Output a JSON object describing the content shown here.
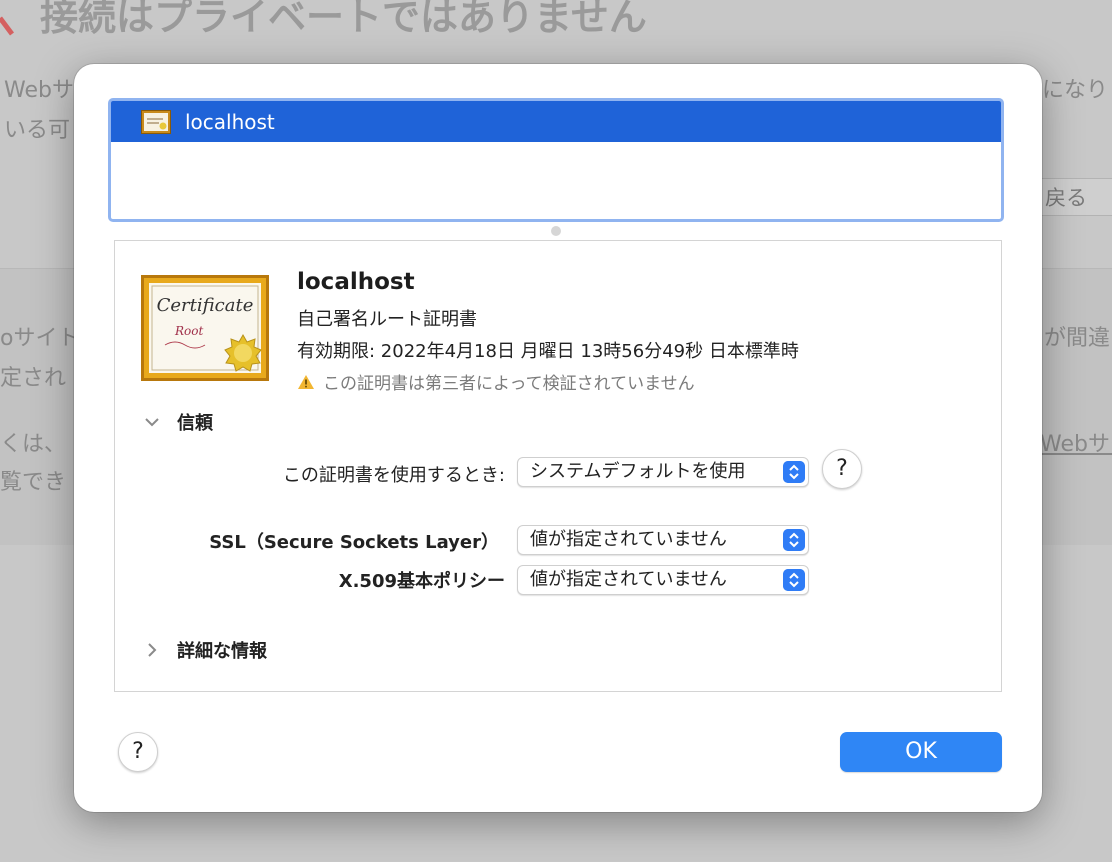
{
  "background": {
    "title": "接続はプライベートではありません",
    "fragments": [
      "Webサ",
      "いる可",
      "になり",
      "戻る",
      "oサイト",
      "定され",
      "が間違",
      "くは、",
      "Webサイ",
      "覧でき"
    ]
  },
  "list": {
    "selected_item": "localhost"
  },
  "certificate": {
    "name": "localhost",
    "type": "自己署名ルート証明書",
    "expiry": "有効期限: 2022年4月18日 月曜日 13時56分49秒 日本標準時",
    "warning": "この証明書は第三者によって検証されていません",
    "image_text_1": "Certificate",
    "image_text_2": "Root"
  },
  "trust": {
    "section_label": "信頼",
    "when_using_label": "この証明書を使用するとき:",
    "when_using_value": "システムデフォルトを使用",
    "ssl_label": "SSL（Secure Sockets Layer）",
    "ssl_value": "値が指定されていません",
    "x509_label": "X.509基本ポリシー",
    "x509_value": "値が指定されていません"
  },
  "details": {
    "section_label": "詳細な情報"
  },
  "buttons": {
    "help": "?",
    "ok": "OK"
  },
  "colors": {
    "selection": "#1f63d8",
    "accent": "#2f86f5",
    "warning": "#f2b632"
  }
}
